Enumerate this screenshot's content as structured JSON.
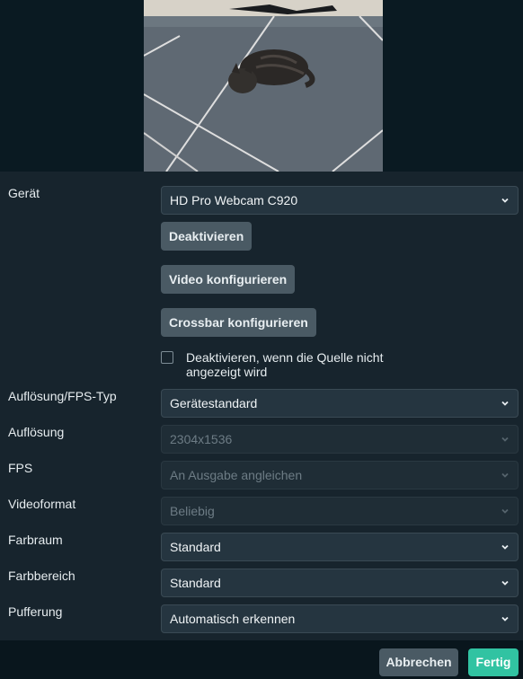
{
  "preview": {
    "icon": "webcam-preview-cat-image"
  },
  "form": {
    "device_label": "Gerät",
    "device_value": "HD Pro Webcam C920",
    "deactivate_button": "Deaktivieren",
    "configure_video_button": "Video konfigurieren",
    "configure_crossbar_button": "Crossbar konfigurieren",
    "deactivate_when_hidden_label": "Deaktivieren, wenn die Quelle nicht angezeigt wird",
    "deactivate_when_hidden_checked": false,
    "resolution_fps_type_label": "Auflösung/FPS-Typ",
    "resolution_fps_type_value": "Gerätestandard",
    "resolution_label": "Auflösung",
    "resolution_value": "2304x1536",
    "fps_label": "FPS",
    "fps_value": "An Ausgabe angleichen",
    "video_format_label": "Videoformat",
    "video_format_value": "Beliebig",
    "color_space_label": "Farbraum",
    "color_space_value": "Standard",
    "color_range_label": "Farbbereich",
    "color_range_value": "Standard",
    "buffering_label": "Pufferung",
    "buffering_value": "Automatisch erkennen"
  },
  "footer": {
    "cancel_button": "Abbrechen",
    "done_button": "Fertig"
  },
  "colors": {
    "accent": "#31c3a2",
    "panel": "#17242d",
    "background": "#09161d"
  }
}
